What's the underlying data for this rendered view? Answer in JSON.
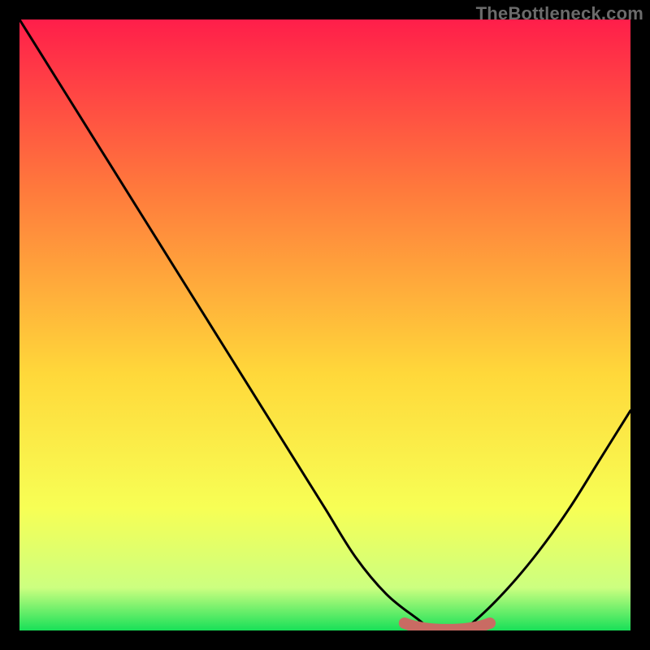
{
  "watermark": "TheBottleneck.com",
  "colors": {
    "page_bg": "#000000",
    "gradient_top": "#ff1e4a",
    "gradient_upper_mid": "#ff7a3c",
    "gradient_mid": "#ffd83a",
    "gradient_lower_mid": "#f7ff55",
    "gradient_near_bottom": "#ccff80",
    "gradient_bottom": "#18e058",
    "curve": "#000000",
    "marker": "#c96b63"
  },
  "chart_data": {
    "type": "line",
    "title": "",
    "xlabel": "",
    "ylabel": "",
    "xlim": [
      0,
      100
    ],
    "ylim": [
      0,
      100
    ],
    "series": [
      {
        "name": "bottleneck-curve",
        "x": [
          0,
          5,
          10,
          15,
          20,
          25,
          30,
          35,
          40,
          45,
          50,
          55,
          60,
          65,
          68,
          72,
          75,
          80,
          85,
          90,
          95,
          100
        ],
        "values": [
          100,
          92,
          84,
          76,
          68,
          60,
          52,
          44,
          36,
          28,
          20,
          12,
          6,
          2,
          0,
          0,
          2,
          7,
          13,
          20,
          28,
          36
        ]
      },
      {
        "name": "optimal-range-marker",
        "x": [
          63,
          65,
          68,
          72,
          75,
          77
        ],
        "values": [
          1.2,
          0.6,
          0.2,
          0.2,
          0.6,
          1.2
        ]
      }
    ],
    "annotations": []
  }
}
